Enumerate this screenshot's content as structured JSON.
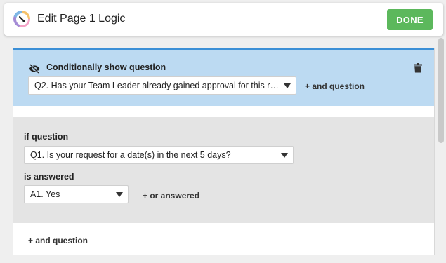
{
  "header": {
    "title": "Edit Page 1 Logic",
    "done_label": "DONE",
    "logo_icon": "app-logo-icon"
  },
  "condition": {
    "title": "Conditionally show question",
    "icon": "eye-off-icon",
    "question_select": "Q2. Has your Team Leader already gained approval for this re…",
    "and_question_label": "+ and question",
    "delete_icon": "trash-icon"
  },
  "rule": {
    "if_question_label": "if question",
    "question_select": "Q1. Is your request for a date(s) in the next 5 days?",
    "is_answered_label": "is answered",
    "answer_select": "A1. Yes",
    "or_answered_label": "+ or answered"
  },
  "footer": {
    "and_question_label": "+ and question"
  },
  "colors": {
    "accent_blue": "#3b8fd6",
    "condition_bg": "#bcdaf2",
    "done_green": "#5cb85c",
    "rule_bg": "#e4e4e4"
  }
}
